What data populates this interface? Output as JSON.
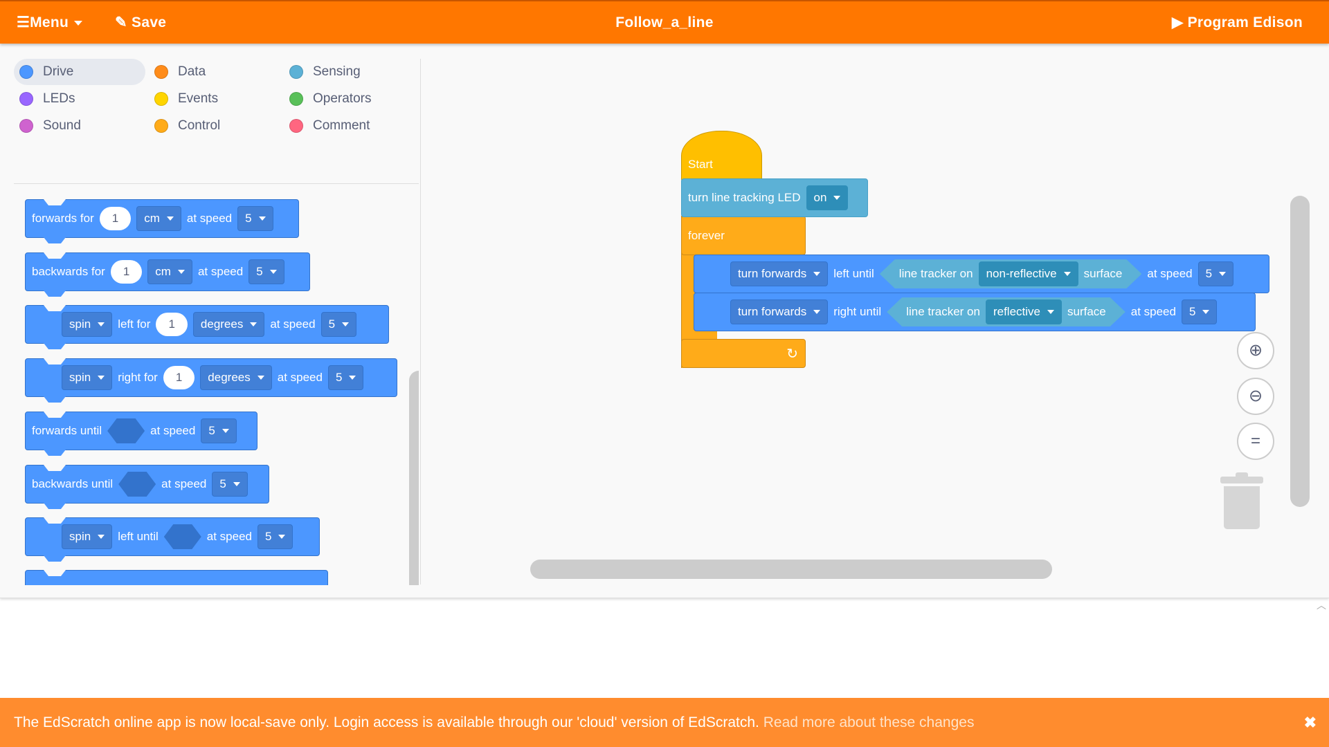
{
  "topbar": {
    "menu_icon": "☰",
    "menu_label": "Menu",
    "save_icon": "✎",
    "save_label": "Save",
    "title": "Follow_a_line",
    "program_icon": "▶",
    "program_label": "Program Edison"
  },
  "categories": [
    {
      "label": "Drive",
      "color": "#4c97ff",
      "selected": true
    },
    {
      "label": "LEDs",
      "color": "#9966ff"
    },
    {
      "label": "Sound",
      "color": "#cf63cf"
    },
    {
      "label": "Data",
      "color": "#ff8c1a"
    },
    {
      "label": "Events",
      "color": "#ffd500"
    },
    {
      "label": "Control",
      "color": "#ffab19"
    },
    {
      "label": "Sensing",
      "color": "#5cb1d6"
    },
    {
      "label": "Operators",
      "color": "#59c059"
    },
    {
      "label": "Comment",
      "color": "#ff6680"
    }
  ],
  "palette": {
    "b1": {
      "t1": "forwards for",
      "val": "1",
      "unit": "cm",
      "t2": "at speed",
      "speed": "5"
    },
    "b2": {
      "t1": "backwards for",
      "val": "1",
      "unit": "cm",
      "t2": "at speed",
      "speed": "5"
    },
    "b3": {
      "dir": "spin",
      "t1": "left for",
      "val": "1",
      "unit": "degrees",
      "t2": "at speed",
      "speed": "5"
    },
    "b4": {
      "dir": "spin",
      "t1": "right for",
      "val": "1",
      "unit": "degrees",
      "t2": "at speed",
      "speed": "5"
    },
    "b5": {
      "t1": "forwards until",
      "t2": "at speed",
      "speed": "5"
    },
    "b6": {
      "t1": "backwards until",
      "t2": "at speed",
      "speed": "5"
    },
    "b7": {
      "dir": "spin",
      "t1": "left until",
      "t2": "at speed",
      "speed": "5"
    }
  },
  "script": {
    "start_label": "Start",
    "led": {
      "label": "turn line tracking LED",
      "value": "on"
    },
    "forever_label": "forever",
    "loop_icon": "↻",
    "inner1": {
      "dir": "turn forwards",
      "t1": "left until",
      "s1": "line tracker on",
      "surface_value": "non-reflective",
      "s2": "surface",
      "t2": "at speed",
      "speed": "5"
    },
    "inner2": {
      "dir": "turn forwards",
      "t1": "right until",
      "s1": "line tracker on",
      "surface_value": "reflective",
      "s2": "surface",
      "t2": "at speed",
      "speed": "5"
    }
  },
  "controls": {
    "zoom_in_icon": "⊕",
    "zoom_out_icon": "⊖",
    "reset_icon": "=",
    "trash_icon": "trash-icon"
  },
  "banner": {
    "text": "The EdScratch online app is now local-save only. Login access is available through our 'cloud' version of EdScratch. ",
    "link": "Read more about these changes",
    "close": "✖"
  }
}
